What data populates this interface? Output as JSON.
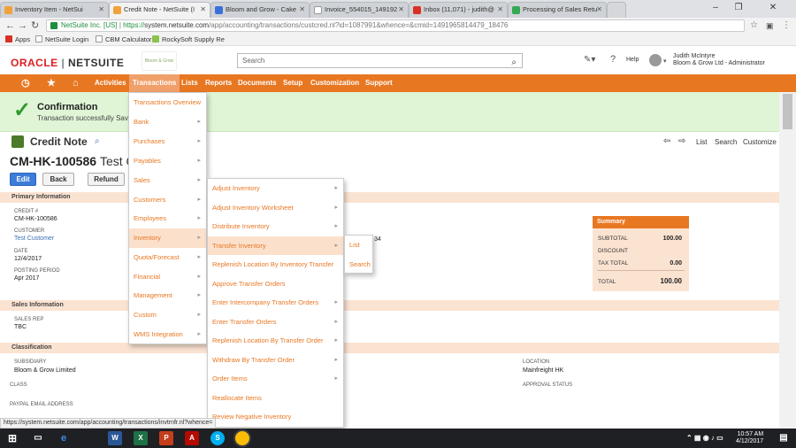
{
  "browser": {
    "tabs": [
      {
        "label": "Inventory Item - NetSui",
        "color": "#f0a23a"
      },
      {
        "label": "Credit Note - NetSuite (I",
        "color": "#f0a23a"
      },
      {
        "label": "Bloom and Grow - Cake",
        "color": "#3b6fd8"
      },
      {
        "label": "Invoice_554015_149192",
        "color": "#ffffff"
      },
      {
        "label": "Inbox (11,071) - judith@",
        "color": "#d93025"
      },
      {
        "label": "Processing of Sales Retu",
        "color": "#34a853"
      }
    ],
    "url_secure": "NetSuite Inc. [US]",
    "url_prefix": "https://",
    "url_host": "system.netsuite.com",
    "url_path": "/app/accounting/transactions/custcred.nl?id=1087991&whence=&cmid=1491965814479_18476",
    "bookmarks": [
      "Apps",
      "NetSuite Login",
      "CBM Calculator",
      "RockySoft Supply Re"
    ]
  },
  "header": {
    "logo_oracle": "ORACLE",
    "logo_netsuite": "NETSUITE",
    "brand": "Bloom & Grow",
    "search_placeholder": "Search",
    "help": "Help",
    "user_name": "Judith McIntyre",
    "user_role": "Bloom & Grow Ltd - Administrator"
  },
  "nav": [
    "Activities",
    "Transactions",
    "Lists",
    "Reports",
    "Documents",
    "Setup",
    "Customization",
    "Support"
  ],
  "confirmation": {
    "title": "Confirmation",
    "text": "Transaction successfully Saved"
  },
  "record": {
    "type": "Credit Note",
    "id": "CM-HK-100586",
    "name_partial": "Test C",
    "nav": [
      "List",
      "Search",
      "Customize"
    ],
    "buttons": {
      "edit": "Edit",
      "back": "Back",
      "refund": "Refund"
    }
  },
  "primary": {
    "title": "Primary Information",
    "credit_label": "CREDIT #",
    "credit_value": "CM-HK-100586",
    "customer_label": "CUSTOMER",
    "customer_value": "Test Customer",
    "date_label": "DATE",
    "date_value": "12/4/2017",
    "period_label": "POSTING PERIOD",
    "period_value": "Apr 2017",
    "partial_value": "34"
  },
  "summary": {
    "title": "Summary",
    "subtotal_label": "SUBTOTAL",
    "subtotal": "100.00",
    "discount_label": "DISCOUNT",
    "tax_label": "TAX TOTAL",
    "tax": "0.00",
    "total_label": "TOTAL",
    "total": "100.00"
  },
  "sales": {
    "title": "Sales Information",
    "rep_label": "SALES REP",
    "rep_value": "TBC"
  },
  "classification": {
    "title": "Classification",
    "subsidiary_label": "SUBSIDIARY",
    "subsidiary_value": "Bloom & Grow Limited",
    "class_label": "CLASS",
    "location_label": "LOCATION",
    "location_value": "Mainfreight HK",
    "approval_label": "APPROVAL STATUS",
    "paypal_label": "PAYPAL EMAIL ADDRESS"
  },
  "menu_transactions": [
    "Transactions Overview",
    "Bank",
    "Purchases",
    "Payables",
    "Sales",
    "Customers",
    "Employees",
    "Inventory",
    "Quota/Forecast",
    "Financial",
    "Management",
    "Custom",
    "WMS Integration"
  ],
  "menu_inventory": [
    "Adjust Inventory",
    "Adjust Inventory Worksheet",
    "Distribute Inventory",
    "Transfer Inventory",
    "Replenish Location By Inventory Transfer",
    "Approve Transfer Orders",
    "Enter Intercompany Transfer Orders",
    "Enter Transfer Orders",
    "Replenish Location By Transfer Order",
    "Withdraw By Transfer Order",
    "Order Items",
    "Reallocate Items",
    "Review Negative Inventory"
  ],
  "menu_transfer": [
    "List",
    "Search"
  ],
  "status_url": "https://system.netsuite.com/app/accounting/transactions/invtrnfr.nl?whence=",
  "taskbar": {
    "time": "10:57 AM",
    "date": "4/12/2017"
  }
}
